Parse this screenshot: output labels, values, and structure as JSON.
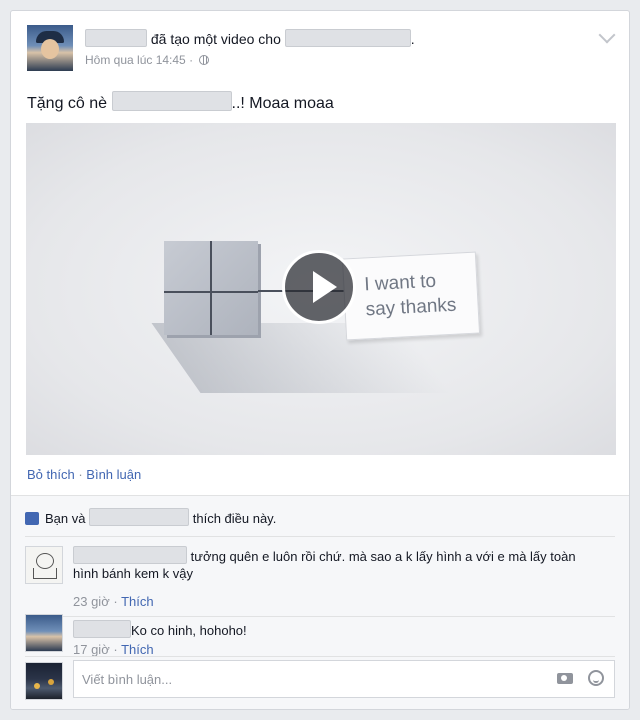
{
  "post": {
    "created_text": "đã tạo một video cho",
    "period": ".",
    "timestamp": "Hôm qua lúc 14:45",
    "dot": "·",
    "message_start": "Tặng cô nè",
    "message_end": "..! Moaa moaa"
  },
  "video": {
    "tag_line1": "I want to",
    "tag_line2": "say thanks"
  },
  "actions": {
    "unlike": "Bỏ thích",
    "dot": "·",
    "comment": "Bình luận"
  },
  "likes": {
    "prefix": "Bạn và",
    "suffix": "thích điều này."
  },
  "comments": [
    {
      "text": "tưởng quên e luôn rồi chứ. mà sao a k lấy hình a với e mà lấy toàn hình bánh kem k vậy",
      "time": "23 giờ",
      "dot": "·",
      "like": "Thích"
    },
    {
      "text": "Ko co hinh, hohoho!",
      "time": "17 giờ",
      "dot": "·",
      "like": "Thích"
    }
  ],
  "composer": {
    "placeholder": "Viết bình luận..."
  },
  "icons": [
    "chevron-down-icon",
    "globe-icon",
    "play-icon",
    "like-thumb-icon",
    "camera-icon",
    "emoji-icon"
  ]
}
